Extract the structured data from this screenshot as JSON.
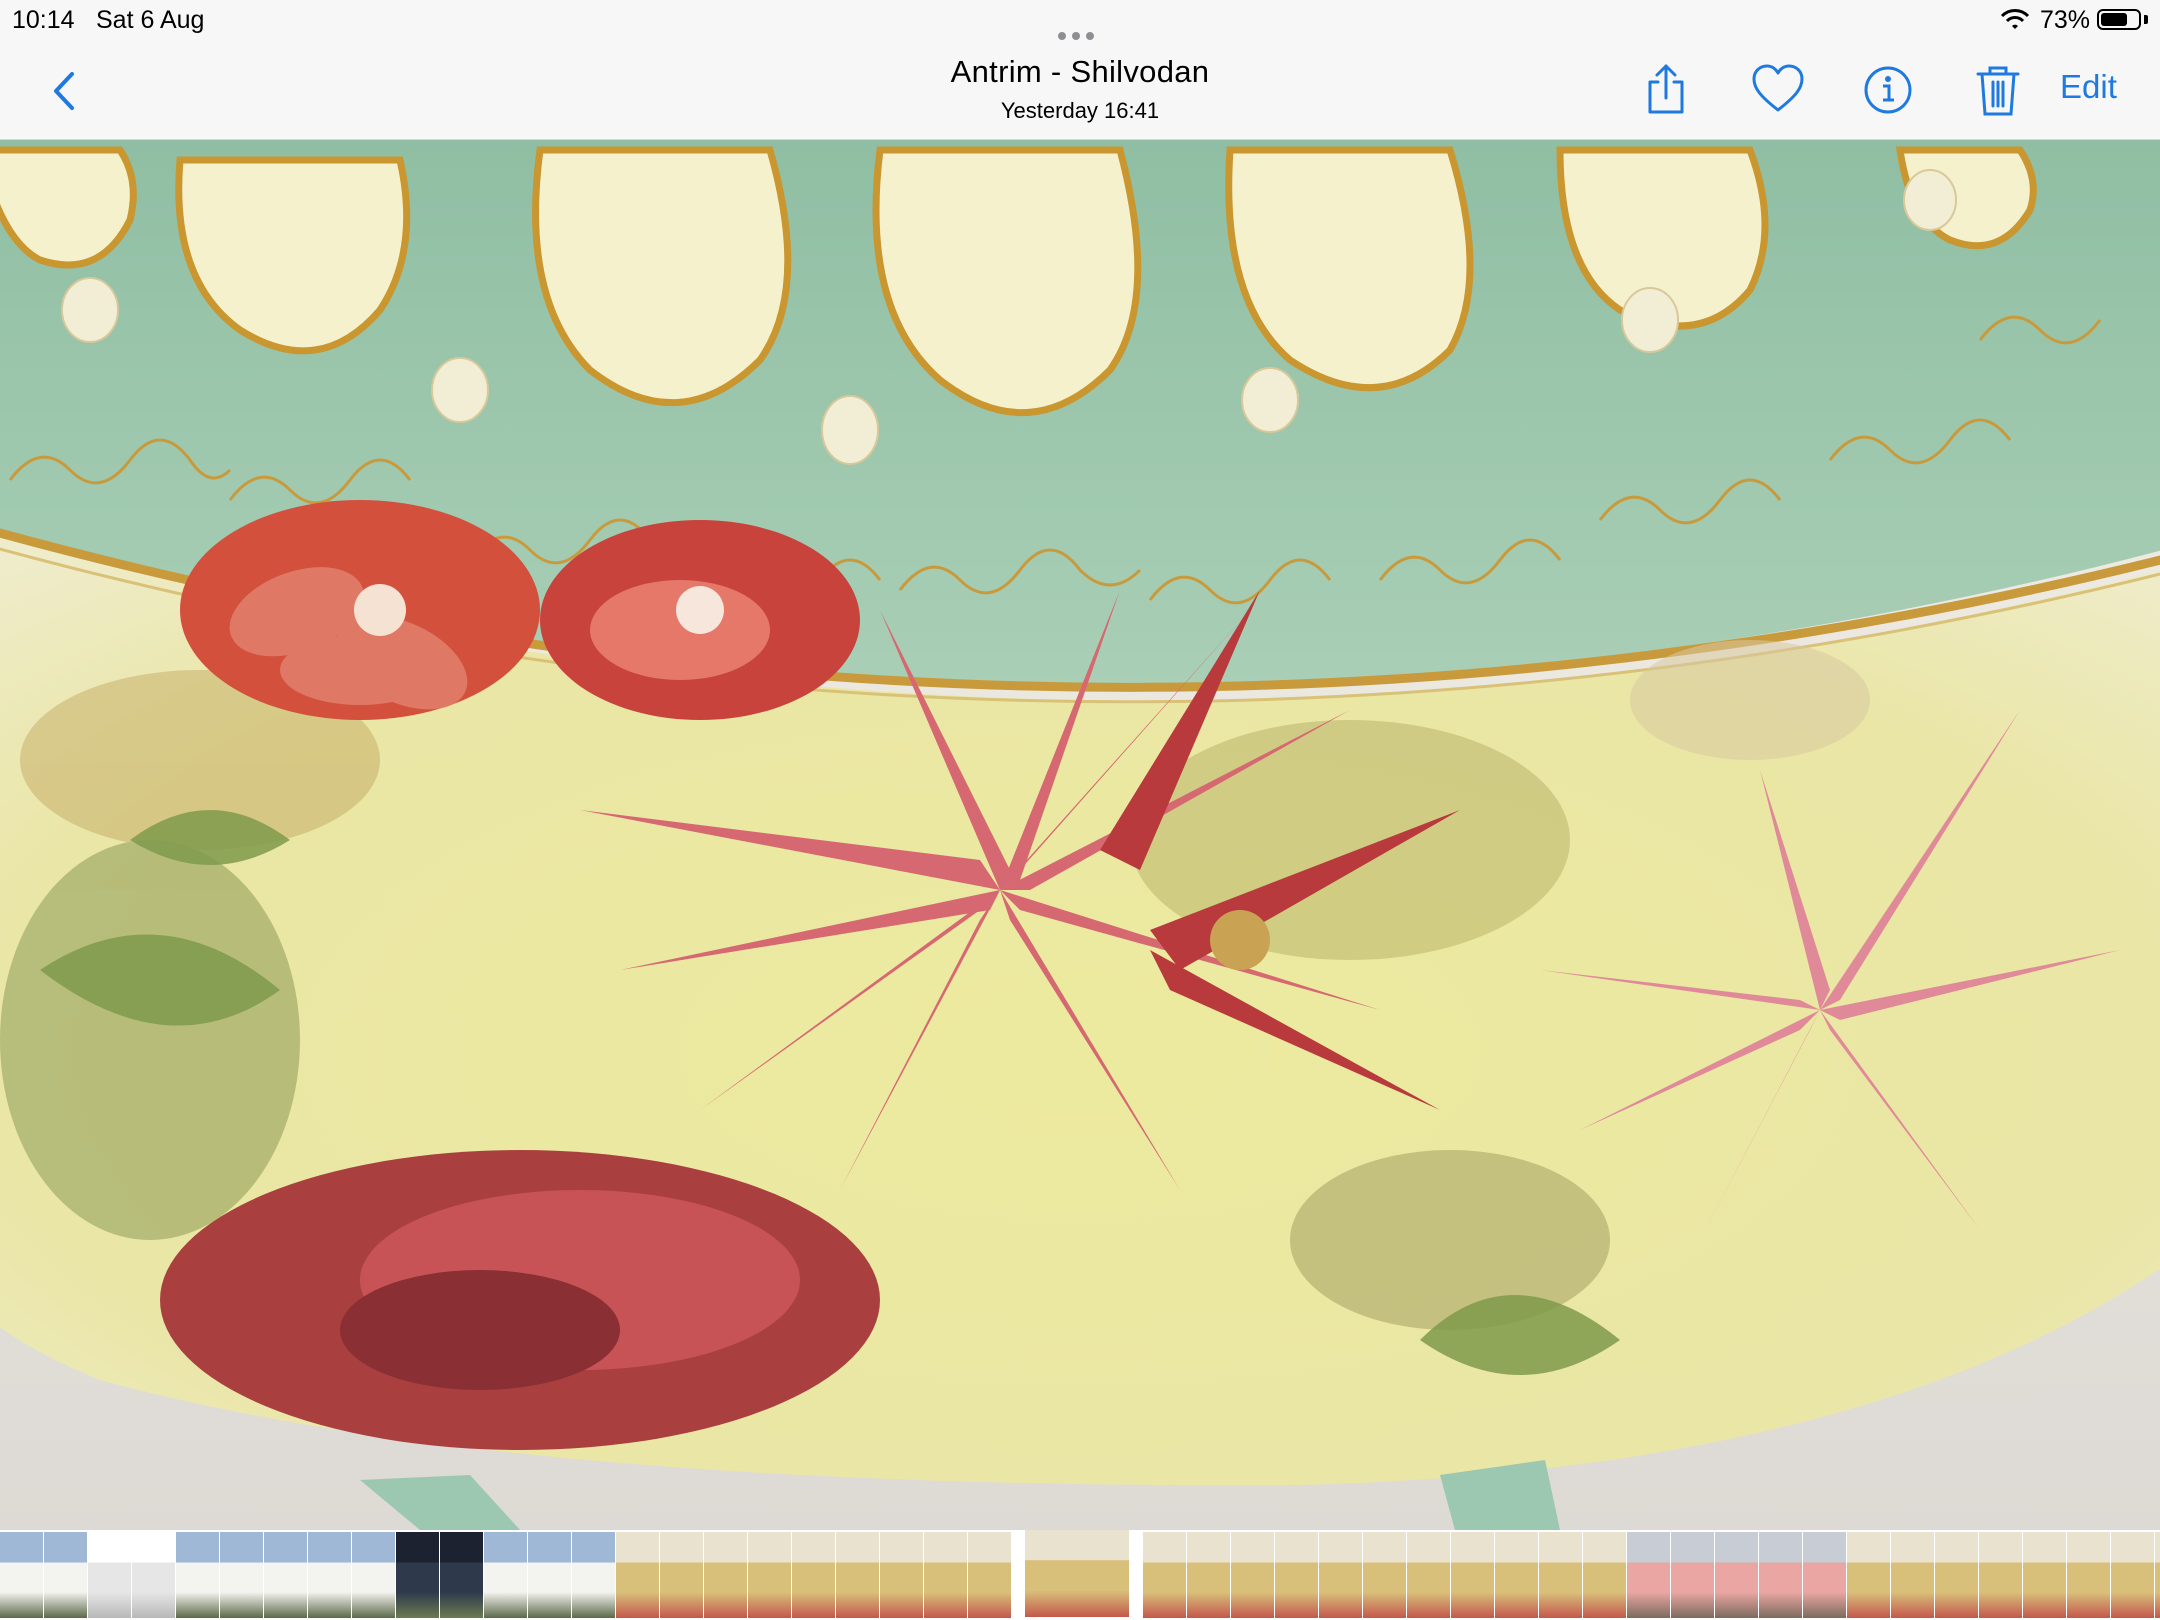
{
  "status_bar": {
    "time": "10:14",
    "date": "Sat 6 Aug",
    "battery_percent": "73%",
    "battery_level": 0.73
  },
  "nav": {
    "title": "Antrim - Shilvodan",
    "subtitle": "Yesterday  16:41",
    "edit_label": "Edit",
    "icons": [
      "chevron-left-icon",
      "share-icon",
      "heart-icon",
      "info-icon",
      "trash-icon"
    ],
    "accent_color": "#1f7ae0"
  },
  "photo": {
    "subject": "hand-painted porcelain bowl with chrysanthemums",
    "colors": {
      "band": "#9cc7b0",
      "cream": "#f3f1cf",
      "gold": "#c99a3c",
      "body": "#e8e7a8",
      "flower_red": "#c9403c",
      "flower_pink": "#d9717d"
    }
  },
  "filmstrip": {
    "thumbnail_kinds": [
      "house",
      "house",
      "document",
      "document",
      "house",
      "house",
      "house",
      "house",
      "house",
      "night",
      "night",
      "house",
      "house",
      "house",
      "vase",
      "vase",
      "vase",
      "vase",
      "vase",
      "vase",
      "vase",
      "vase",
      "vase",
      "vase",
      "vase",
      "vase",
      "vase",
      "vase",
      "vase",
      "vase",
      "vase",
      "vase",
      "vase",
      "vase",
      "vase",
      "person",
      "person",
      "person",
      "person",
      "person",
      "vase",
      "vase",
      "vase",
      "vase",
      "vase",
      "vase",
      "vase",
      "vase"
    ],
    "selected_index": 23
  }
}
